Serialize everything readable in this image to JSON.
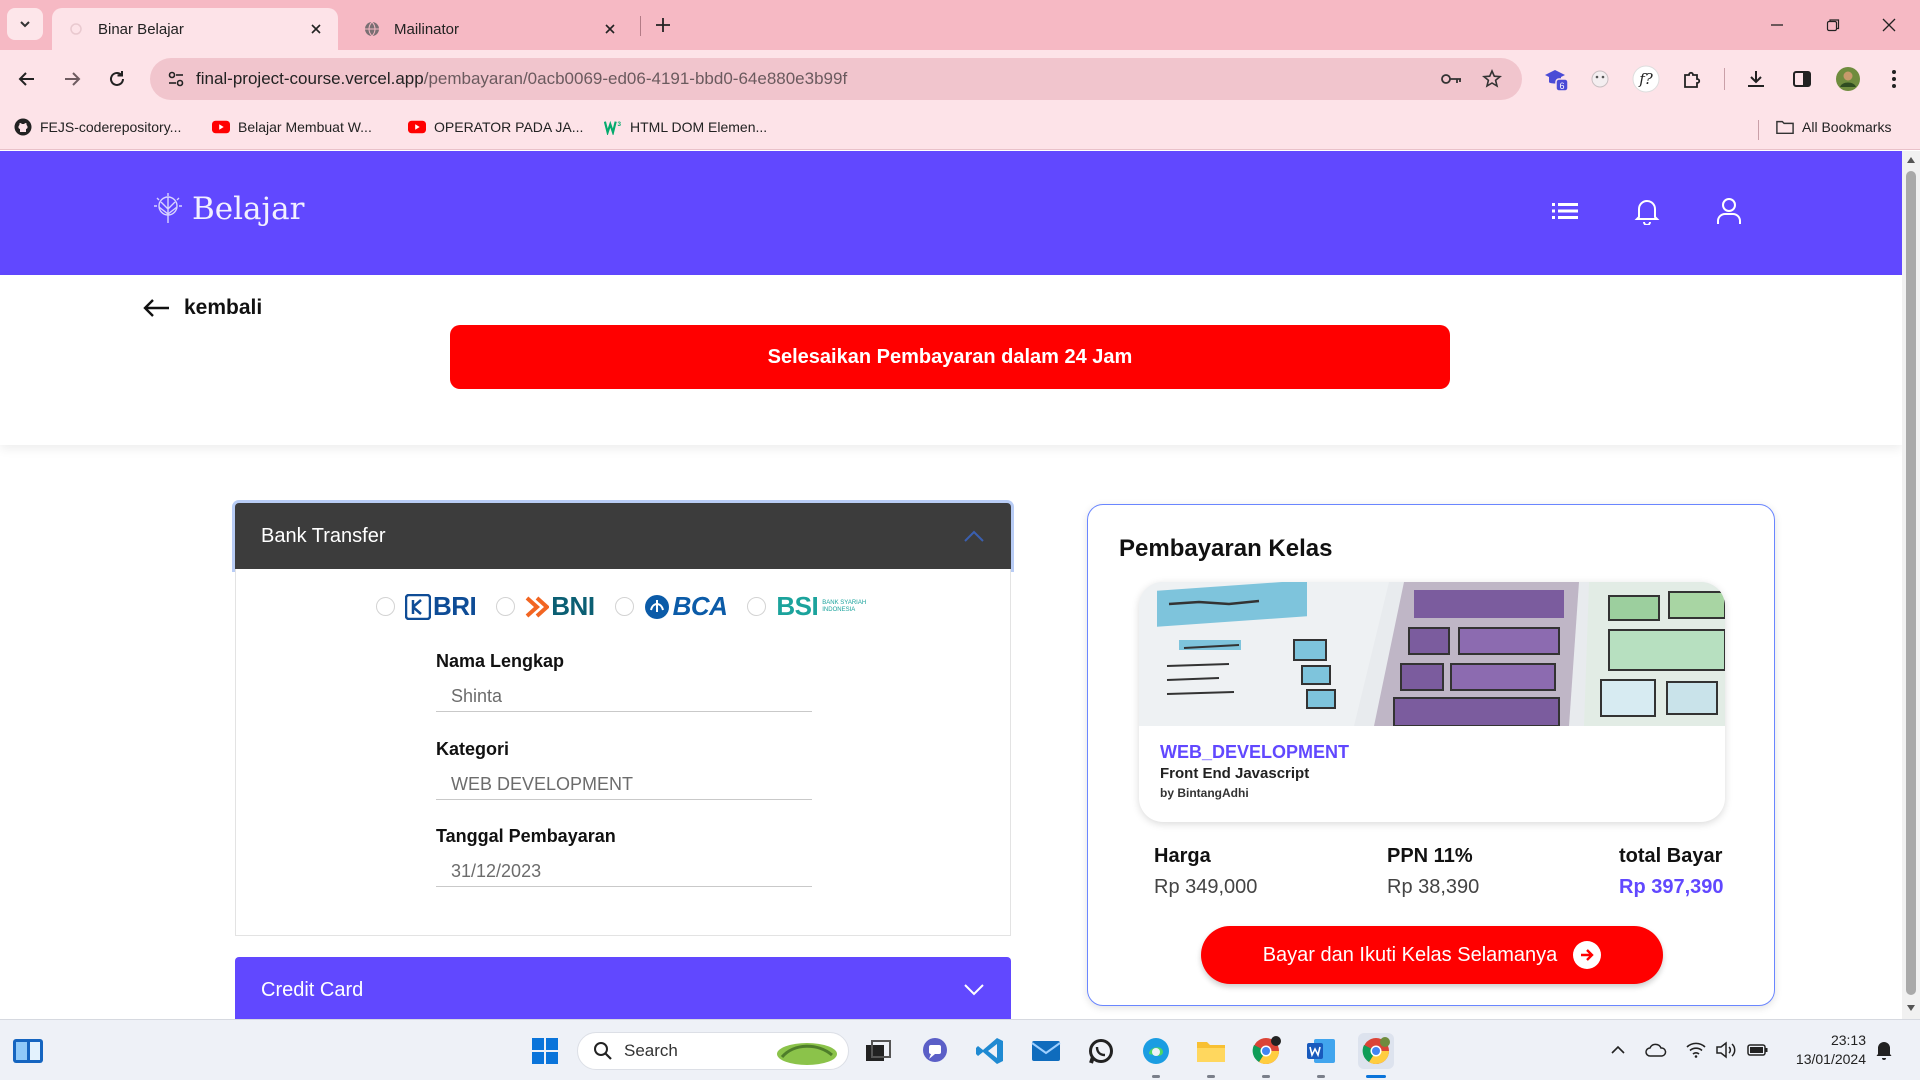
{
  "browser": {
    "tabs": [
      {
        "title": "Binar Belajar",
        "active": true
      },
      {
        "title": "Mailinator",
        "active": false
      }
    ],
    "url_domain": "final-project-course.vercel.app",
    "url_path": "/pembayaran/0acb0069-ed06-4191-bbd0-64e880e3b99f",
    "extension_badge": "6",
    "bookmarks": [
      {
        "label": "FEJS-coderepository...",
        "icon": "github-icon"
      },
      {
        "label": "Belajar Membuat W...",
        "icon": "youtube-icon"
      },
      {
        "label": "OPERATOR PADA JA...",
        "icon": "youtube-icon"
      },
      {
        "label": "HTML DOM Elemen...",
        "icon": "w3schools-icon"
      }
    ],
    "all_bookmarks": "All Bookmarks"
  },
  "app": {
    "logo_text": "Belajar",
    "back_label": "kembali",
    "alert_text": "Selesaikan Pembayaran dalam 24 Jam"
  },
  "payment": {
    "bank_transfer_label": "Bank Transfer",
    "credit_card_label": "Credit Card",
    "banks": [
      {
        "name": "BRI"
      },
      {
        "name": "BNI"
      },
      {
        "name": "BCA"
      },
      {
        "name": "BSI",
        "subtitle": "BANK SYARIAH INDONESIA"
      }
    ],
    "fields": [
      {
        "label": "Nama Lengkap",
        "value": "Shinta"
      },
      {
        "label": "Kategori",
        "value": "WEB DEVELOPMENT"
      },
      {
        "label": "Tanggal Pembayaran",
        "value": "31/12/2023"
      }
    ]
  },
  "summary": {
    "title": "Pembayaran Kelas",
    "course_category": "WEB_DEVELOPMENT",
    "course_title": "Front End Javascript",
    "course_author": "by BintangAdhi",
    "price_label": "Harga",
    "price_value": "Rp 349,000",
    "tax_label": "PPN 11%",
    "tax_value": "Rp 38,390",
    "total_label": "total Bayar",
    "total_value": "Rp 397,390",
    "pay_button": "Bayar dan Ikuti Kelas Selamanya"
  },
  "taskbar": {
    "search_label": "Search",
    "time": "23:13",
    "date": "13/01/2024"
  },
  "colors": {
    "brand_purple": "#6148ff",
    "alert_red": "#ff0000",
    "chrome_pink": "#f6b9c4"
  }
}
